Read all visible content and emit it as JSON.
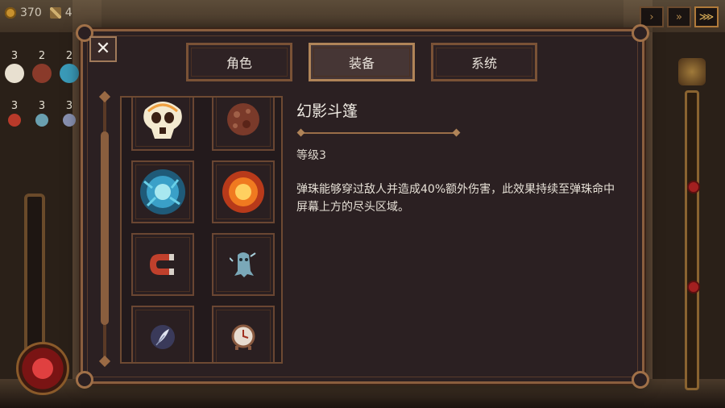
{
  "hud": {
    "coins": "370",
    "wands": "4"
  },
  "pickups": [
    {
      "count": "3",
      "icon": "skull-icon",
      "color": "#e8e0d0"
    },
    {
      "count": "2",
      "icon": "rock-icon",
      "color": "#8a3a2a"
    },
    {
      "count": "2",
      "icon": "blue-fire-icon",
      "color": "#3a9ab8"
    },
    {
      "count": "3",
      "icon": "magnet-icon",
      "color": "#b83a2a"
    },
    {
      "count": "3",
      "icon": "ghost-icon",
      "color": "#6aa0b0"
    },
    {
      "count": "3",
      "icon": "feather-icon",
      "color": "#8890b0"
    }
  ],
  "speed_buttons": [
    {
      "label": "›",
      "active": false
    },
    {
      "label": "»",
      "active": false
    },
    {
      "label": "⋙",
      "active": true
    }
  ],
  "modal": {
    "close_label": "✕",
    "tabs": [
      {
        "label": "角色",
        "active": false
      },
      {
        "label": "装备",
        "active": true
      },
      {
        "label": "系统",
        "active": false
      }
    ],
    "items": [
      {
        "name": "skull-item",
        "icon": "skull-icon",
        "color": "#f0e6c8"
      },
      {
        "name": "rock-item",
        "icon": "rock-icon",
        "color": "#8a4a34"
      },
      {
        "name": "blue-flame-item",
        "icon": "blue-fire-icon",
        "color": "#4ab0d0"
      },
      {
        "name": "fireball-item",
        "icon": "fireball-icon",
        "color": "#f09030"
      },
      {
        "name": "magnet-item",
        "icon": "magnet-icon",
        "color": "#c0402c"
      },
      {
        "name": "phantom-cloak-item",
        "icon": "ghost-icon",
        "color": "#8ab8c8"
      },
      {
        "name": "feather-item",
        "icon": "feather-icon",
        "color": "#c8cce0"
      },
      {
        "name": "clock-item",
        "icon": "clock-icon",
        "color": "#d8c8b8"
      }
    ],
    "detail": {
      "title": "幻影斗篷",
      "level": "等级3",
      "description": "弹珠能够穿过敌人并造成40%额外伤害，此效果持续至弹珠命中屏幕上方的尽头区域。"
    }
  },
  "colors": {
    "panel_bg": "#2b2022",
    "frame": "#8a5e3e",
    "text": "#e6e0d6"
  }
}
